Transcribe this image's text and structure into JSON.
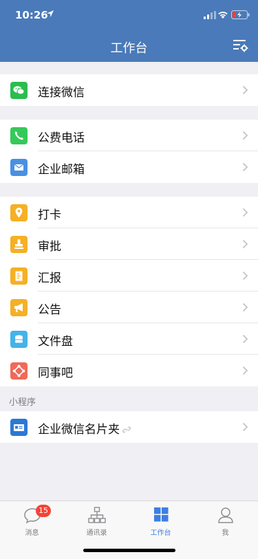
{
  "status_bar": {
    "time": "10:26"
  },
  "header": {
    "title": "工作台"
  },
  "groups": {
    "g1": [
      {
        "label": "连接微信",
        "icon": "wechat-icon",
        "color": "#2bbd4f"
      }
    ],
    "g2": [
      {
        "label": "公费电话",
        "icon": "phone-icon",
        "color": "#35c95a"
      },
      {
        "label": "企业邮箱",
        "icon": "mail-icon",
        "color": "#4a90e2"
      }
    ],
    "g3": [
      {
        "label": "打卡",
        "icon": "location-pin-icon",
        "color": "#f5b025"
      },
      {
        "label": "审批",
        "icon": "stamp-icon",
        "color": "#f5b025"
      },
      {
        "label": "汇报",
        "icon": "report-icon",
        "color": "#f5b025"
      },
      {
        "label": "公告",
        "icon": "megaphone-icon",
        "color": "#f5b025"
      },
      {
        "label": "文件盘",
        "icon": "disk-icon",
        "color": "#45b3e8"
      },
      {
        "label": "同事吧",
        "icon": "colleague-icon",
        "color": "#f06a5a"
      }
    ]
  },
  "mini_programs": {
    "section_label": "小程序",
    "items": [
      {
        "label": "企业微信名片夹",
        "icon": "business-card-icon",
        "color": "#2b78d6"
      }
    ]
  },
  "tabbar": {
    "tabs": [
      {
        "label": "消息",
        "badge": "15",
        "icon": "chat-bubble-icon"
      },
      {
        "label": "通讯录",
        "icon": "org-chart-icon"
      },
      {
        "label": "工作台",
        "icon": "workbench-grid-icon",
        "active": true
      },
      {
        "label": "我",
        "icon": "person-icon"
      }
    ]
  },
  "colors": {
    "header_bg": "#4a7ab9",
    "active_tab": "#3d7ee3",
    "badge": "#f44336"
  }
}
